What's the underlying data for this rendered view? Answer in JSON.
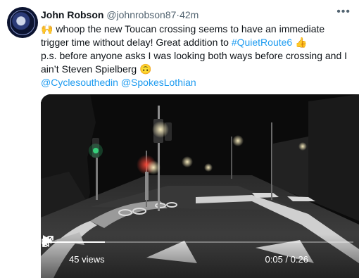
{
  "tweet": {
    "author_name": "John Robson",
    "author_handle": "@johnrobson87",
    "separator": "·",
    "time": "42m",
    "more_icon": "more-dots-icon",
    "text_line1_emoji": "🙌",
    "text_line1": "whoop the new Toucan crossing seems to have an immediate trigger time without delay! Great addition to",
    "hashtag": "#QuietRoute6",
    "hashtag_emoji": "👍",
    "text_line2": "p.s. before anyone asks I was looking both ways before crossing and I ain’t Steven Spielberg",
    "text_line2_emoji": "🙃",
    "mention1": "@Cyclesouthedin",
    "mention2": "@SpokesLothian"
  },
  "video": {
    "views": "45 views",
    "current_time": "0:05",
    "time_separator": " / ",
    "duration": "0:26",
    "progress_fraction": 0.19,
    "play_icon": "play-icon",
    "volume_icon": "volume-icon",
    "fullscreen_icon": "fullscreen-icon"
  },
  "colors": {
    "link": "#1d9bf0",
    "text": "#0f1419",
    "muted": "#536471"
  }
}
